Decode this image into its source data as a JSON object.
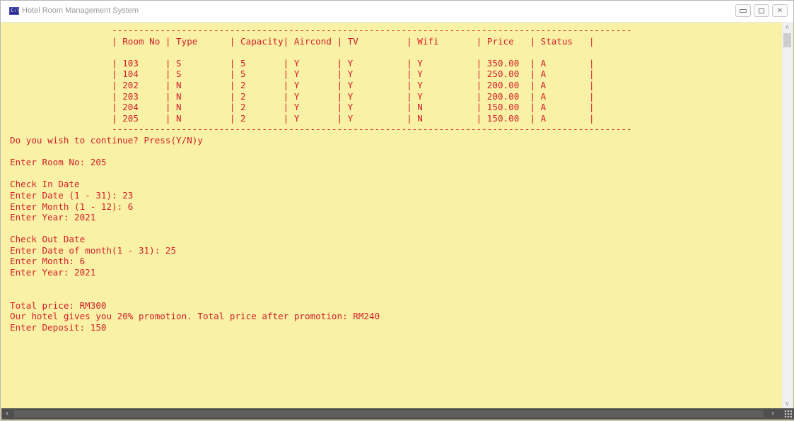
{
  "window": {
    "title": "Hotel Room Management System",
    "icon": "console-app-icon"
  },
  "room_table": {
    "border_line": "-------------------------------------------------------------------------------------------------",
    "columns": [
      "Room No",
      "Type",
      "Capacity",
      "Aircond",
      "TV",
      "Wifi",
      "Price",
      "Status"
    ],
    "rows": [
      [
        "103",
        "S",
        "5",
        "Y",
        "Y",
        "Y",
        "350.00",
        "A"
      ],
      [
        "104",
        "S",
        "5",
        "Y",
        "Y",
        "Y",
        "250.00",
        "A"
      ],
      [
        "202",
        "N",
        "2",
        "Y",
        "Y",
        "Y",
        "200.00",
        "A"
      ],
      [
        "203",
        "N",
        "2",
        "Y",
        "Y",
        "Y",
        "200.00",
        "A"
      ],
      [
        "204",
        "N",
        "2",
        "Y",
        "Y",
        "N",
        "150.00",
        "A"
      ],
      [
        "205",
        "N",
        "2",
        "Y",
        "Y",
        "N",
        "150.00",
        "A"
      ]
    ]
  },
  "console_lines": [
    "Do you wish to continue? Press(Y/N)y",
    "",
    "Enter Room No: 205",
    "",
    "Check In Date",
    "Enter Date (1 - 31): 23",
    "Enter Month (1 - 12): 6",
    "Enter Year: 2021",
    "",
    "Check Out Date",
    "Enter Date of month(1 - 31): 25",
    "Enter Month: 6",
    "Enter Year: 2021",
    "",
    "",
    "Total price: RM300",
    "Our hotel gives you 20% promotion. Total price after promotion: RM240",
    "Enter Deposit: 150"
  ],
  "colors": {
    "console_background": "#f9f1a5",
    "console_text": "#d4202a"
  }
}
